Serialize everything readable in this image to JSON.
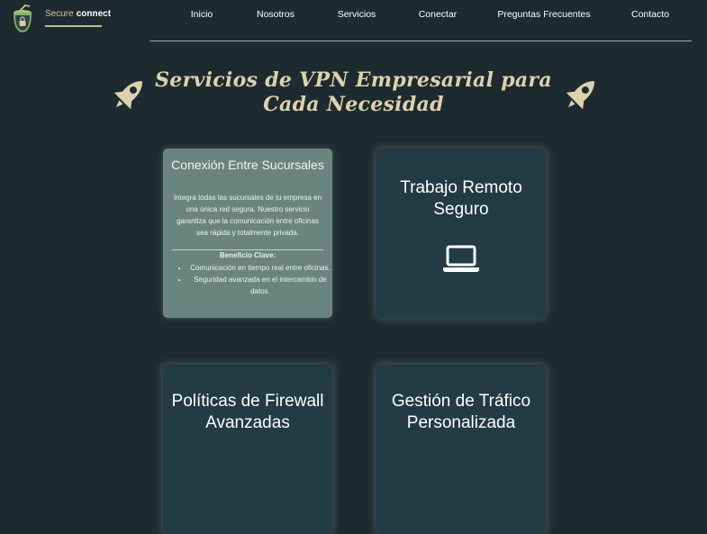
{
  "brand": {
    "part1": "Secure",
    "part2": "connect"
  },
  "nav": [
    {
      "label": "Inicio"
    },
    {
      "label": "Nosotros"
    },
    {
      "label": "Servicios"
    },
    {
      "label": "Conectar"
    },
    {
      "label": "Preguntas Frecuentes"
    },
    {
      "label": "Contacto"
    }
  ],
  "page_title": "Servicios de VPN Empresarial para Cada Necesidad",
  "cards": [
    {
      "title": "Conexión Entre Sucursales",
      "description": "Integra todas las sucursales de tu empresa en una única red segura. Nuestro servicio garantiza que la comunicación entre oficinas sea rápida y totalmente privada.",
      "benefit_title": "Beneficio Clave:",
      "benefits": [
        "Comunicación en tiempo real entre oficinas.",
        "Seguridad avanzada en el intercambio de datos."
      ]
    },
    {
      "title": "Trabajo Remoto Seguro",
      "icon": "laptop-icon"
    },
    {
      "title": "Políticas de Firewall Avanzadas"
    },
    {
      "title": "Gestión de Tráfico Personalizada"
    }
  ],
  "colors": {
    "background": "#1d2b30",
    "card": "#223b44",
    "card_flipped": "#6a857e",
    "accent": "#ddd2ae"
  }
}
